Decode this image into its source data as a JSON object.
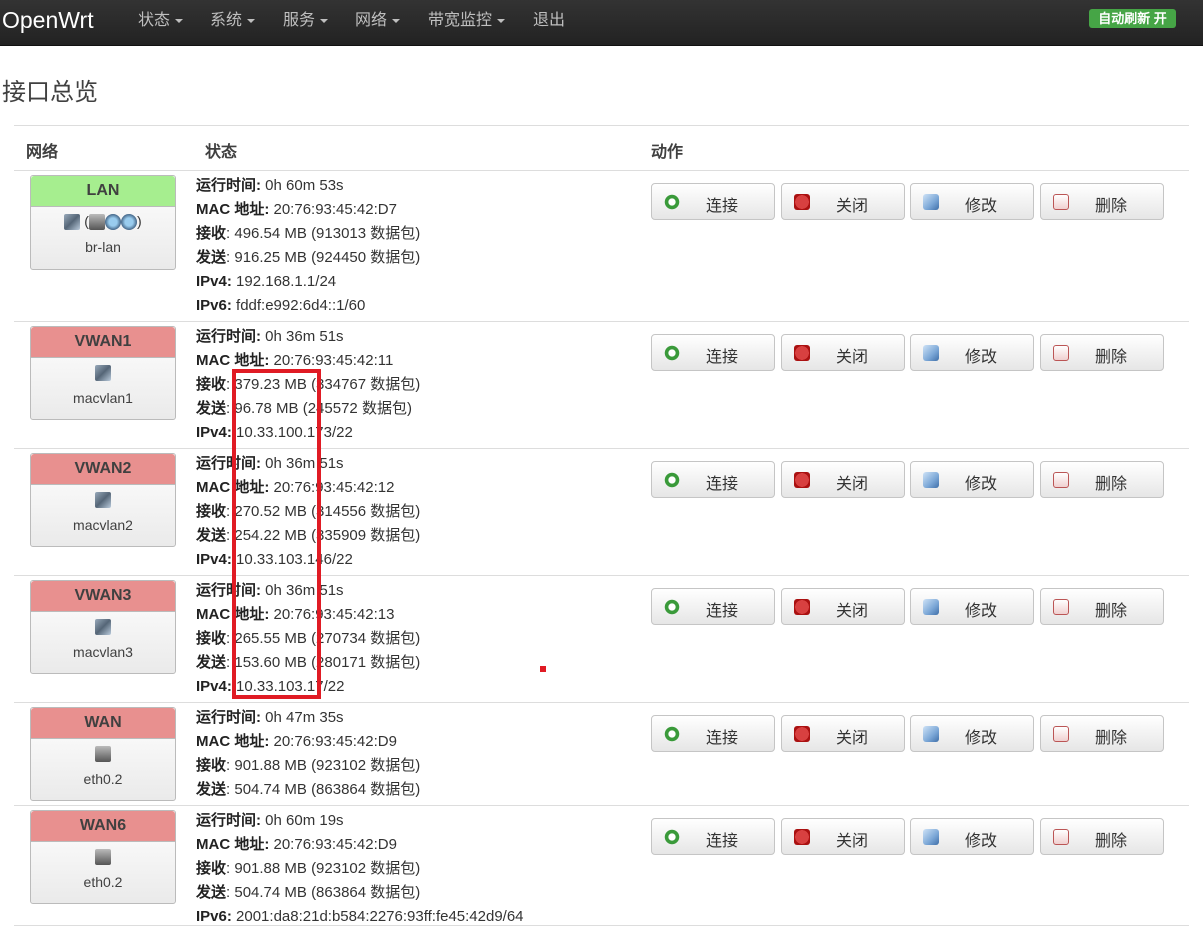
{
  "navbar": {
    "brand": "OpenWrt",
    "menu": [
      {
        "label": "状态",
        "dropdown": true
      },
      {
        "label": "系统",
        "dropdown": true
      },
      {
        "label": "服务",
        "dropdown": true
      },
      {
        "label": "网络",
        "dropdown": true
      },
      {
        "label": "带宽监控",
        "dropdown": true
      },
      {
        "label": "退出",
        "dropdown": false
      }
    ],
    "auto_refresh": "自动刷新 开"
  },
  "page_title": "接口总览",
  "table": {
    "headers": {
      "network": "网络",
      "status": "状态",
      "actions": "动作"
    },
    "buttons": {
      "connect": "连接",
      "close": "关闭",
      "edit": "修改",
      "delete": "删除"
    },
    "labels": {
      "uptime": "运行时间:",
      "mac": "MAC 地址:",
      "rx": "接收",
      "tx": "发送",
      "ipv4": "IPv4:",
      "ipv6": "IPv6:"
    },
    "rows": [
      {
        "name": "LAN",
        "color": "#a6ee8f",
        "device": "br-lan",
        "icons": "(…)",
        "uptime": "0h 60m 53s",
        "mac": "20:76:93:45:42:D7",
        "rx": ": 496.54 MB (913013 数据包)",
        "tx": ": 916.25 MB (924450 数据包)",
        "ipv4": "192.168.1.1/24",
        "ipv6": "fddf:e992:6d4::1/60"
      },
      {
        "name": "VWAN1",
        "color": "#e8908f",
        "device": "macvlan1",
        "uptime": "0h 36m 51s",
        "mac": "20:76:93:45:42:11",
        "rx": ": 379.23 MB (334767 数据包)",
        "tx": ": 96.78 MB (245572 数据包)",
        "ipv4": "10.33.100.173/22"
      },
      {
        "name": "VWAN2",
        "color": "#e8908f",
        "device": "macvlan2",
        "uptime": "0h 36m 51s",
        "mac": "20:76:93:45:42:12",
        "rx": ": 270.52 MB (314556 数据包)",
        "tx": ": 254.22 MB (335909 数据包)",
        "ipv4": "10.33.103.146/22"
      },
      {
        "name": "VWAN3",
        "color": "#e8908f",
        "device": "macvlan3",
        "uptime": "0h 36m 51s",
        "mac": "20:76:93:45:42:13",
        "rx": ": 265.55 MB (270734 数据包)",
        "tx": ": 153.60 MB (280171 数据包)",
        "ipv4": "10.33.103.17/22"
      },
      {
        "name": "WAN",
        "color": "#e8908f",
        "device": "eth0.2",
        "uptime": "0h 47m 35s",
        "mac": "20:76:93:45:42:D9",
        "rx": ": 901.88 MB (923102 数据包)",
        "tx": ": 504.74 MB (863864 数据包)"
      },
      {
        "name": "WAN6",
        "color": "#e8908f",
        "device": "eth0.2",
        "uptime": "0h 60m 19s",
        "mac": "20:76:93:45:42:D9",
        "rx": ": 901.88 MB (923102 数据包)",
        "tx": ": 504.74 MB (863864 数据包)",
        "ipv6": "2001:da8:21d:b584:2276:93ff:fe45:42d9/64"
      }
    ]
  }
}
